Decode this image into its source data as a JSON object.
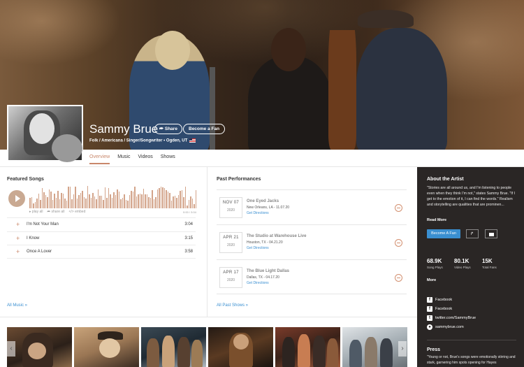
{
  "artist": {
    "name": "Sammy Brue",
    "share_label": "Share",
    "fan_label": "Become a Fan",
    "meta": "Folk / Americana / Singer/Songwriter  •  Ogden, UT"
  },
  "tabs": [
    "Overview",
    "Music",
    "Videos",
    "Shows"
  ],
  "featured_songs": {
    "title": "Featured Songs",
    "play_all": "play all",
    "share_all": "share all",
    "embed": "embed",
    "time": "0:00 / 3:04",
    "songs": [
      {
        "title": "I'm Not Your Man",
        "duration": "3:04"
      },
      {
        "title": "I Know",
        "duration": "3:15"
      },
      {
        "title": "Once A Lover",
        "duration": "3:58"
      }
    ],
    "all_link": "All Music »"
  },
  "past_performances": {
    "title": "Past Performances",
    "items": [
      {
        "month_day": "NOV 07",
        "year": "2020",
        "venue": "One Eyed Jacks",
        "location": "New Orleans, LA - 11.07.20",
        "directions": "Get Directions"
      },
      {
        "month_day": "APR 21",
        "year": "2020",
        "venue": "The Studio at Warehouse Live",
        "location": "Houston, TX - 04.21.20",
        "directions": "Get Directions"
      },
      {
        "month_day": "APR 17",
        "year": "2020",
        "venue": "The Blue Light Dallas",
        "location": "Dallas, TX - 04.17.20",
        "directions": "Get Directions"
      }
    ],
    "all_link": "All Past Shows »"
  },
  "sidebar": {
    "about_title": "About the Artist",
    "bio": "\"Stories are all around us, and I'm listening to people even when they think I'm not,\" states Sammy Brue. \"If I get to the emotion of it, I can find the words.\" Realism and storytelling are qualities that are prominen...",
    "read_more": "Read More",
    "fan_button": "Become A Fan",
    "stats": [
      {
        "value": "68.9K",
        "label": "Song Plays"
      },
      {
        "value": "80.1K",
        "label": "Video Plays"
      },
      {
        "value": "15K",
        "label": "Total Fans"
      }
    ],
    "more": "More",
    "links": [
      {
        "icon": "facebook-icon",
        "label": "Facebook"
      },
      {
        "icon": "facebook-icon",
        "label": "Facebook"
      },
      {
        "icon": "twitter-icon",
        "label": "twitter.com/SammyBrue"
      },
      {
        "icon": "globe-icon",
        "label": "sammybrue.com"
      }
    ],
    "press_title": "Press",
    "press_text": "\"Young or not, Brue's songs were emotionally stirring and stark, garnering him spots opening for Hayes"
  },
  "colors": {
    "accent": "#c9876a",
    "link": "#3a8fd1",
    "sidebar_bg": "#2a2625"
  }
}
